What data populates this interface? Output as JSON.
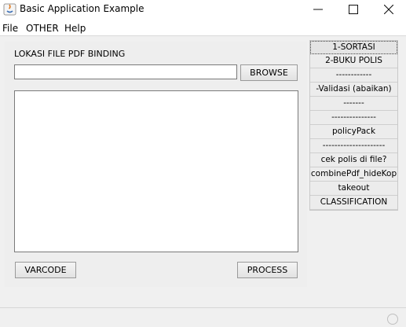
{
  "window": {
    "title": "Basic Application Example",
    "controls": {
      "minimize": "—",
      "maximize": "☐",
      "close": "✕"
    }
  },
  "menubar": {
    "items": [
      "File",
      "OTHER",
      "Help"
    ]
  },
  "main": {
    "pdf_label": "LOKASI FILE PDF BINDING",
    "pdf_path_value": "",
    "browse_label": "BROWSE",
    "output_text": "",
    "varcode_label": "VARCODE",
    "process_label": "PROCESS"
  },
  "sidebar": {
    "items": [
      "1-SORTASI",
      "2-BUKU POLIS",
      "------------",
      "-Validasi (abaikan)",
      "-------",
      "---------------",
      "policyPack",
      "---------------------",
      "cek polis di file?",
      "combinePdf_hideKop",
      "takeout",
      "CLASSIFICATION"
    ],
    "active_index": 0
  },
  "colors": {
    "app_icon_orange": "#e07a1f",
    "app_icon_blue": "#3b6fb6"
  }
}
